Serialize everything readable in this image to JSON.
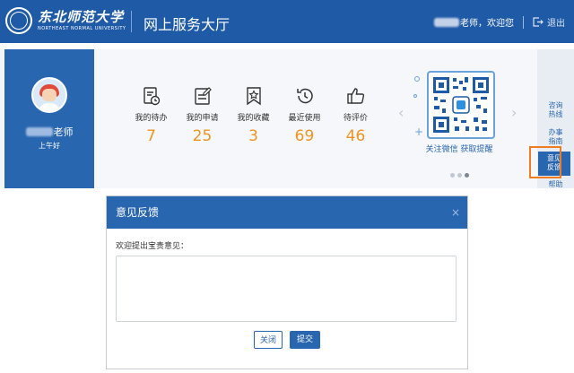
{
  "header": {
    "logo_cn": "东北师范大学",
    "logo_en": "NORTHEAST NORMAL UNIVERSITY",
    "title": "网上服务大厅",
    "welcome": "老师，欢迎您",
    "logout": "退出"
  },
  "profile": {
    "name_suffix": "老师",
    "greeting": "上午好"
  },
  "stats": [
    {
      "label": "我的待办",
      "value": "7",
      "icon": "clipboard-clock-icon"
    },
    {
      "label": "我的申请",
      "value": "25",
      "icon": "edit-document-icon"
    },
    {
      "label": "我的收藏",
      "value": "3",
      "icon": "bookmark-star-icon"
    },
    {
      "label": "最近使用",
      "value": "69",
      "icon": "history-icon"
    },
    {
      "label": "待评价",
      "value": "46",
      "icon": "thumbs-up-icon"
    }
  ],
  "qr": {
    "caption": "关注微信 获取提醒"
  },
  "side_nav": [
    {
      "line1": "咨询",
      "line2": "热线"
    },
    {
      "line1": "办事",
      "line2": "指南"
    },
    {
      "line1": "意见",
      "line2": "反馈"
    },
    {
      "line1": "帮助",
      "line2": ""
    }
  ],
  "modal": {
    "title": "意见反馈",
    "close_x": "×",
    "prompt": "欢迎提出宝贵意见：",
    "textarea_value": "",
    "close_button": "关闭",
    "submit_button": "提交"
  },
  "colors": {
    "brand": "#1f5aa6",
    "accent": "#f0941f",
    "highlight": "#f07c22"
  }
}
